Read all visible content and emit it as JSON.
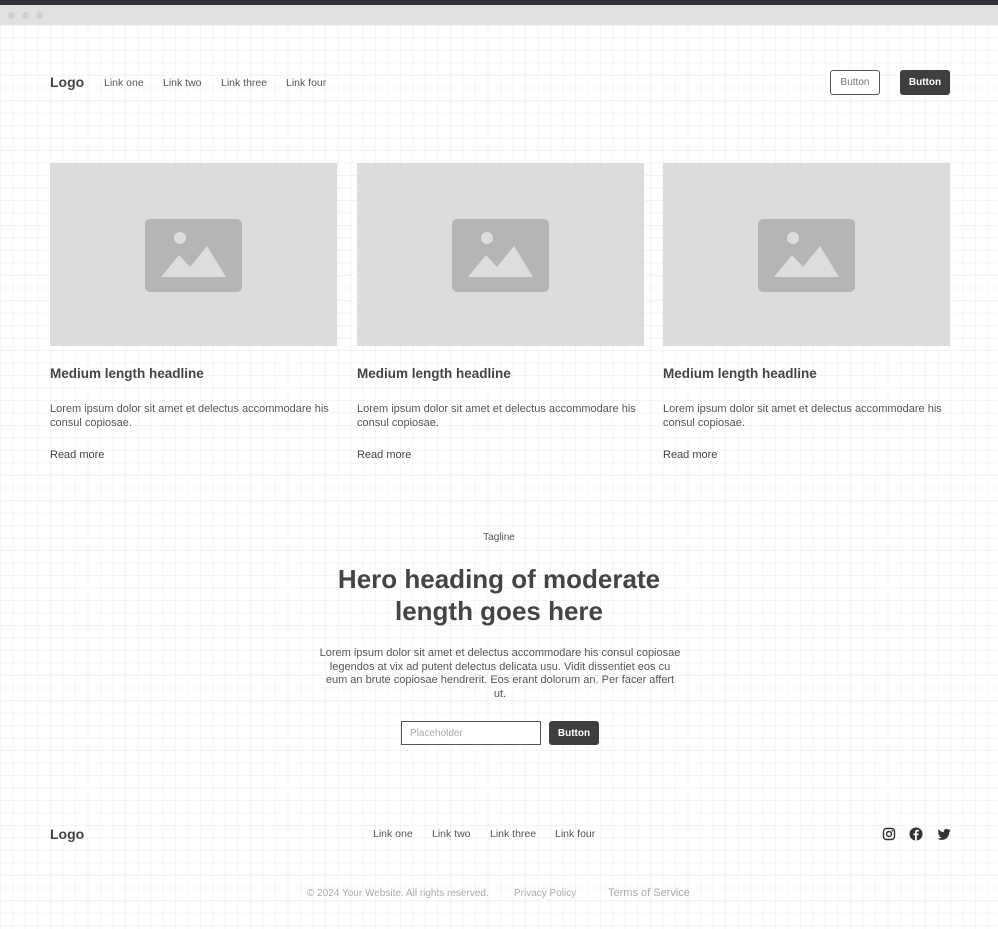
{
  "header": {
    "logo": "Logo",
    "links": [
      "Link one",
      "Link two",
      "Link three",
      "Link four"
    ],
    "secondary_button": "Button",
    "primary_button": "Button"
  },
  "cards": [
    {
      "headline": "Medium length headline",
      "body": "Lorem ipsum dolor sit amet et delectus accommodare his consul copiosae.",
      "link": "Read more",
      "image_icon": "image-placeholder-icon"
    },
    {
      "headline": "Medium length headline",
      "body": "Lorem ipsum dolor sit amet et delectus accommodare his consul copiosae.",
      "link": "Read more",
      "image_icon": "image-placeholder-icon"
    },
    {
      "headline": "Medium length headline",
      "body": "Lorem ipsum dolor sit amet et delectus accommodare his consul copiosae.",
      "link": "Read more",
      "image_icon": "image-placeholder-icon"
    }
  ],
  "hero": {
    "tagline": "Tagline",
    "heading": "Hero heading of moderate length goes here",
    "body": "Lorem ipsum dolor sit amet et delectus accommodare his consul copiosae legendos at vix ad putent delectus delicata usu. Vidit dissentiet eos cu eum an brute copiosae hendrerit. Eos erant dolorum an. Per facer affert ut.",
    "input_placeholder": "Placeholder",
    "input_value": "",
    "button": "Button"
  },
  "footer": {
    "logo": "Logo",
    "links": [
      "Link one",
      "Link two",
      "Link three",
      "Link four"
    ],
    "social_icons": [
      "instagram-icon",
      "facebook-icon",
      "twitter-icon"
    ],
    "copyright": "© 2024 Your Website. All rights reserved.",
    "privacy": "Privacy Policy",
    "terms": "Terms of Service"
  },
  "colors": {
    "dark_button": "#3f3f3f",
    "placeholder_image": "#dcdcdc",
    "image_icon": "#b5b5b5",
    "window_bar": "#30303a"
  }
}
